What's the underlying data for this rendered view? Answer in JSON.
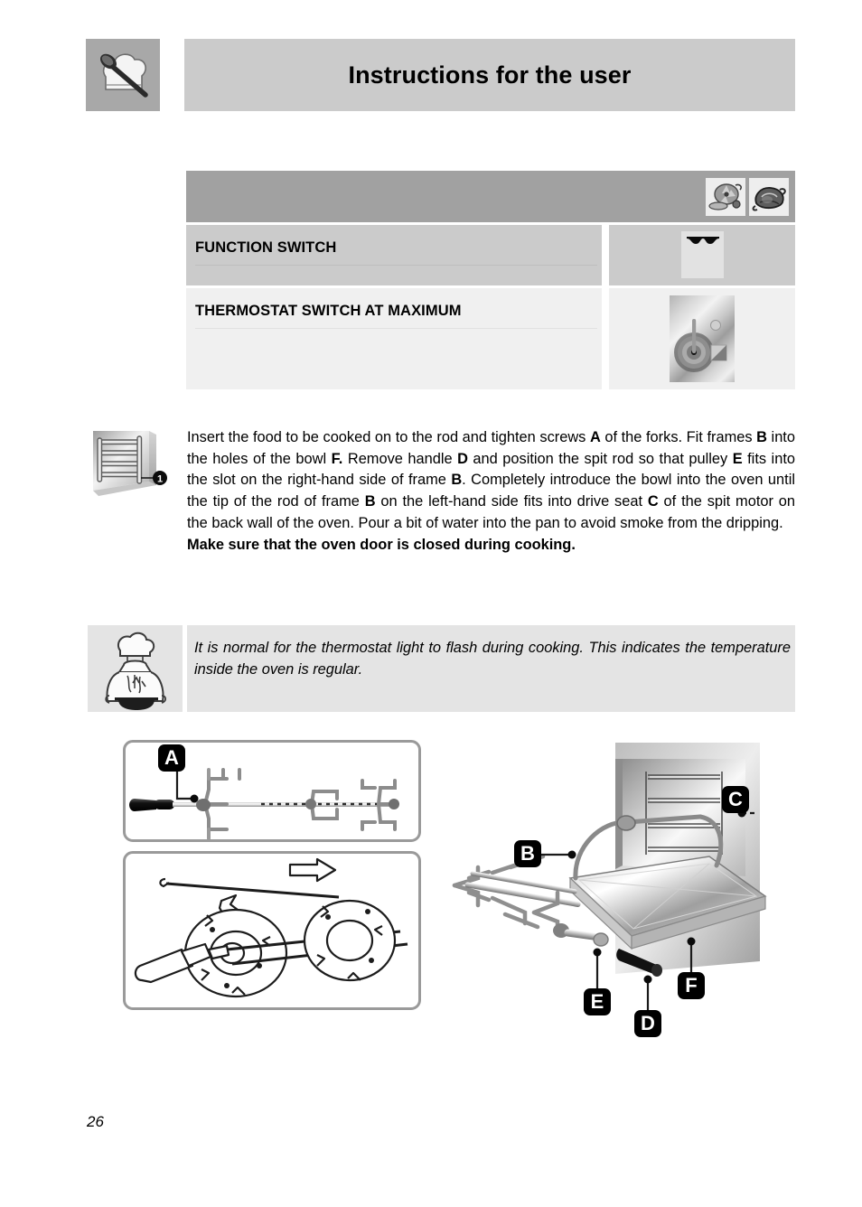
{
  "header": {
    "title": "Instructions for the user",
    "logo_icon": "chef-hat-spoon-icon"
  },
  "spec_table": {
    "head_icons": [
      {
        "name": "roast-fan-icon",
        "label": ""
      },
      {
        "name": "roast-chicken-icon",
        "label": ""
      }
    ],
    "rows": [
      {
        "label": "FUNCTION SWITCH",
        "icon_name": "grill-element-icon",
        "icon_kind": "grill"
      },
      {
        "label": "THERMOSTAT SWITCH AT MAXIMUM",
        "icon_name": "thermostat-knob-icon",
        "icon_kind": "knob"
      }
    ]
  },
  "margin_icon": {
    "name": "oven-side-rack-icon",
    "callout": "1"
  },
  "body": {
    "segments": [
      {
        "t": "Insert the food to be cooked on to the rod and tighten screws ",
        "b": false
      },
      {
        "t": "A",
        "b": true
      },
      {
        "t": " of the forks. Fit frames ",
        "b": false
      },
      {
        "t": "B",
        "b": true
      },
      {
        "t": " into the holes of the bowl ",
        "b": false
      },
      {
        "t": "F.",
        "b": true
      },
      {
        "t": " Remove handle ",
        "b": false
      },
      {
        "t": "D",
        "b": true
      },
      {
        "t": " and position the spit rod so that pulley ",
        "b": false
      },
      {
        "t": "E",
        "b": true
      },
      {
        "t": " fits into the slot on the right-hand side of frame ",
        "b": false
      },
      {
        "t": "B",
        "b": true
      },
      {
        "t": ". Completely introduce the bowl into the oven until the tip of the rod of frame ",
        "b": false
      },
      {
        "t": "B",
        "b": true
      },
      {
        "t": " on the left-hand side fits into drive seat ",
        "b": false
      },
      {
        "t": "C",
        "b": true
      },
      {
        "t": " of the spit motor on the back wall of the oven. Pour a bit of water into the pan to avoid smoke from the dripping.",
        "b": false
      }
    ],
    "bold_line": "Make sure that the oven door is closed during cooking."
  },
  "note": {
    "icon_name": "chef-cooking-icon",
    "text": "It is normal for the thermostat light to flash during cooking. This indicates the temperature inside the oven is regular."
  },
  "diagram": {
    "panel_a": {
      "name": "spit-rod-and-forks-panel",
      "badges": [
        "A"
      ]
    },
    "panel_b": {
      "name": "spit-support-frames-panel",
      "badges": []
    },
    "oven_scene": {
      "name": "oven-with-rotisserie-scene",
      "badges": [
        "B",
        "C",
        "D",
        "E",
        "F"
      ]
    }
  },
  "footer": {
    "page_number": "26"
  },
  "colors": {
    "header_bar": "#cbcbcb",
    "logo_bg": "#a8a8a8",
    "table_head": "#a1a1a1",
    "row_dark": "#cbcbcb",
    "row_light": "#f0f0f0",
    "note_bg": "#e4e4e4",
    "panel_border": "#9a9a9a"
  }
}
